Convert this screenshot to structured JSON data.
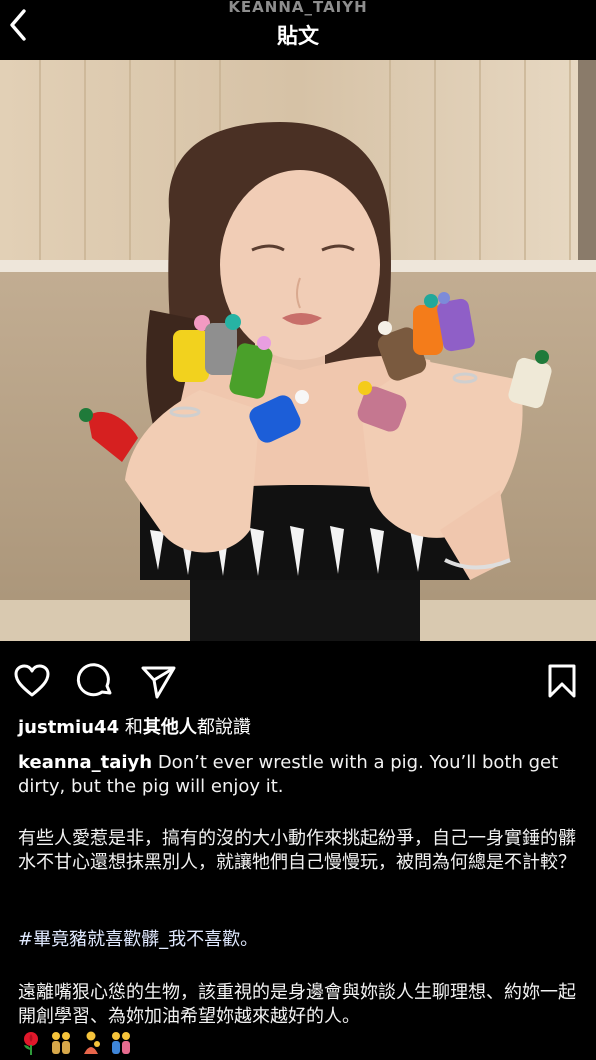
{
  "header": {
    "account": "KEANNA_TAIYH",
    "title": "貼文"
  },
  "likes": {
    "first_user": "justmiu44",
    "connector": " 和",
    "others": "其他人",
    "suffix": "都說讚"
  },
  "caption": {
    "username": "keanna_taiyh",
    "english": " Don’t ever wrestle with a pig. You’ll both get dirty, but the pig will enjoy it.",
    "para1": "有些人愛惹是非，搞有的沒的大小動作來挑起紛爭，自己一身實錘的髒水不甘心還想抹黑別人，就讓牠們自己慢慢玩，被問為何總是不計較？",
    "hashtag": "#畢竟豬就喜歡髒_我不喜歡。",
    "para2": "遠離嘴狠心慫的生物，該重視的是身邊會與妳談人生聊理想、約妳一起開創學習、為妳加油希望妳越來越好的人。"
  },
  "icons": {
    "back": "chevron-left-icon",
    "like": "heart-icon",
    "comment": "comment-bubble-icon",
    "share": "paper-plane-icon",
    "save": "bookmark-icon",
    "emojis": [
      "rose-emoji",
      "people-emoji",
      "people-emoji",
      "people-emoji"
    ]
  }
}
